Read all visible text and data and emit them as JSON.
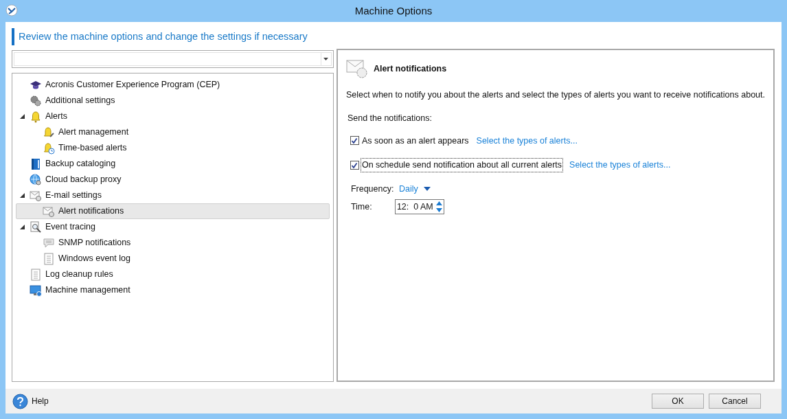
{
  "window": {
    "title": "Machine Options"
  },
  "heading": "Review the machine options and change the settings if necessary",
  "tree": [
    {
      "label": "Acronis Customer Experience Program (CEP)",
      "selected": false
    },
    {
      "label": "Additional settings",
      "selected": false
    },
    {
      "label": "Alerts",
      "selected": false,
      "expanded": true,
      "children": [
        {
          "label": "Alert management",
          "selected": false
        },
        {
          "label": "Time-based alerts",
          "selected": false
        }
      ]
    },
    {
      "label": "Backup cataloging",
      "selected": false
    },
    {
      "label": "Cloud backup proxy",
      "selected": false
    },
    {
      "label": "E-mail settings",
      "selected": false,
      "expanded": true,
      "children": [
        {
          "label": "Alert notifications",
          "selected": true
        }
      ]
    },
    {
      "label": "Event tracing",
      "selected": false,
      "expanded": true,
      "children": [
        {
          "label": "SNMP notifications",
          "selected": false
        },
        {
          "label": "Windows event log",
          "selected": false
        }
      ]
    },
    {
      "label": "Log cleanup rules",
      "selected": false
    },
    {
      "label": "Machine management",
      "selected": false
    }
  ],
  "panel": {
    "title": "Alert notifications",
    "description": "Select when to notify you about the alerts and select the types of alerts you want to receive notifications about.",
    "send_label": "Send the notifications:",
    "options": [
      {
        "label": "As soon as an alert appears",
        "checked": true,
        "focused": false,
        "link": "Select the types of alerts..."
      },
      {
        "label": "On schedule send notification about all current alerts",
        "checked": true,
        "focused": true,
        "link": "Select the types of alerts..."
      }
    ],
    "frequency": {
      "label": "Frequency:",
      "value": "Daily"
    },
    "time": {
      "label": "Time:",
      "value": "12:  0 AM"
    }
  },
  "footer": {
    "help": "Help",
    "buttons": [
      "OK",
      "Cancel"
    ]
  }
}
